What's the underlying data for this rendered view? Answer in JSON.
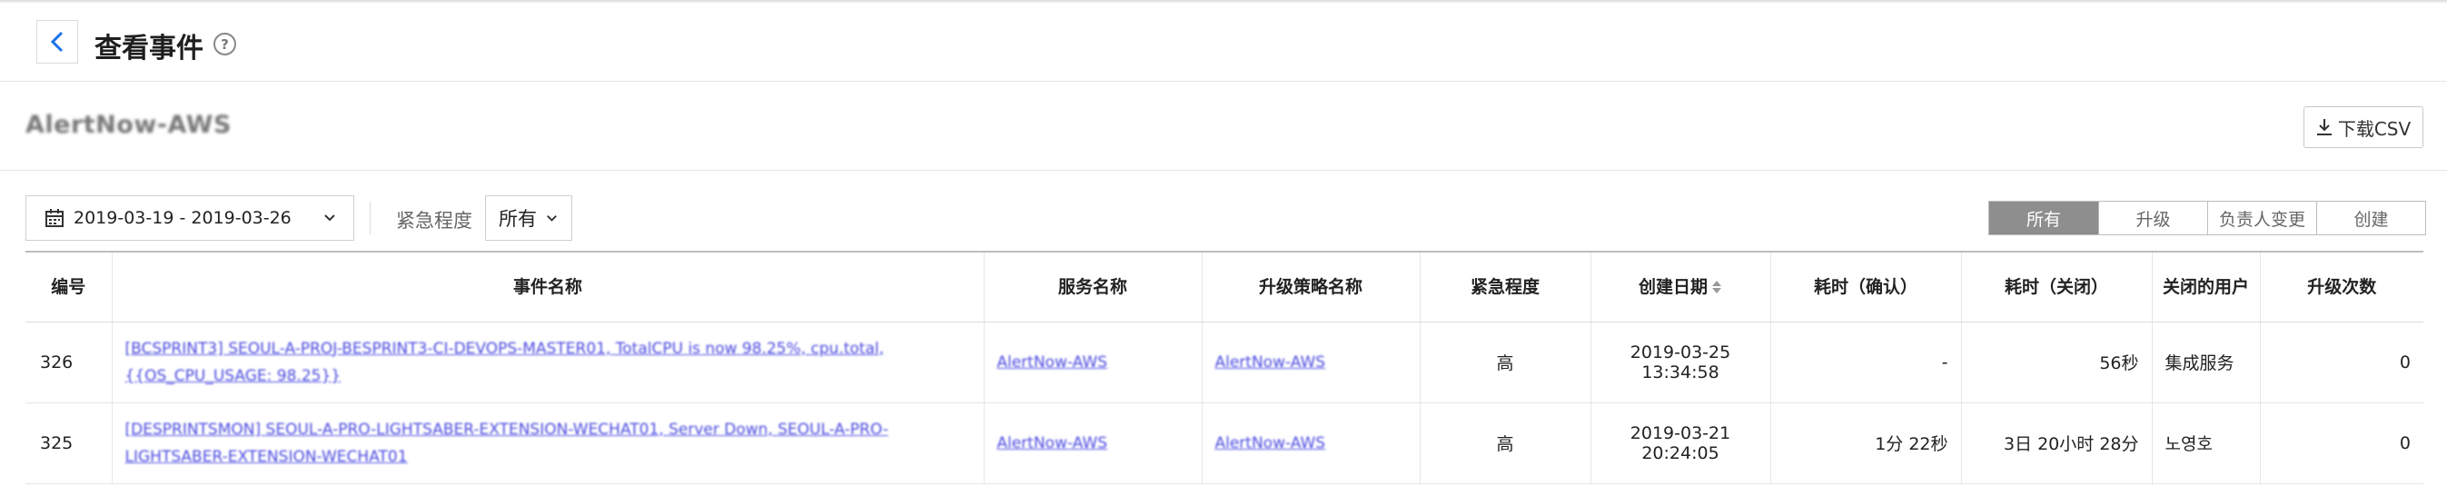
{
  "header": {
    "title": "查看事件",
    "help_glyph": "?"
  },
  "service": {
    "name": "AlertNow-AWS",
    "csv_button": "下载CSV"
  },
  "filters": {
    "date_range": "2019-03-19 - 2019-03-26",
    "urgency_label": "紧急程度",
    "urgency_value": "所有",
    "segments": [
      "所有",
      "升级",
      "负责人变更",
      "创建"
    ],
    "active_segment": "所有"
  },
  "table": {
    "columns": [
      "编号",
      "事件名称",
      "服务名称",
      "升级策略名称",
      "紧急程度",
      "创建日期",
      "耗时（确认）",
      "耗时（关闭）",
      "关闭的用户",
      "升级次数"
    ],
    "rows": [
      {
        "id": "326",
        "event_name": "[BCSPRINT3] SEOUL-A-PROJ-BESPRINT3-CI-DEVOPS-MASTER01, TotalCPU is now 98.25%, cpu.total, {{OS_CPU_USAGE: 98.25}}",
        "service_name": "AlertNow-AWS",
        "policy_name": "AlertNow-AWS",
        "urgency": "高",
        "created": "2019-03-25 13:34:58",
        "ack_time": "-",
        "close_time": "56秒",
        "closed_by": "集成服务",
        "escalations": "0"
      },
      {
        "id": "325",
        "event_name": "[DESPRINTSMON] SEOUL-A-PRO-LIGHTSABER-EXTENSION-WECHAT01, Server Down, SEOUL-A-PRO-LIGHTSABER-EXTENSION-WECHAT01",
        "service_name": "AlertNow-AWS",
        "policy_name": "AlertNow-AWS",
        "urgency": "高",
        "created": "2019-03-21 20:24:05",
        "ack_time": "1分 22秒",
        "close_time": "3日 20小时 28分",
        "closed_by": "노영호",
        "escalations": "0"
      }
    ]
  },
  "colors": {
    "link": "#4a4ae0",
    "active_segment_bg": "#8e8e8e",
    "back_arrow": "#1a73e8"
  },
  "icons": [
    "chevron-left-icon",
    "help-icon",
    "download-icon",
    "calendar-icon",
    "chevron-down-icon",
    "sort-icon"
  ]
}
